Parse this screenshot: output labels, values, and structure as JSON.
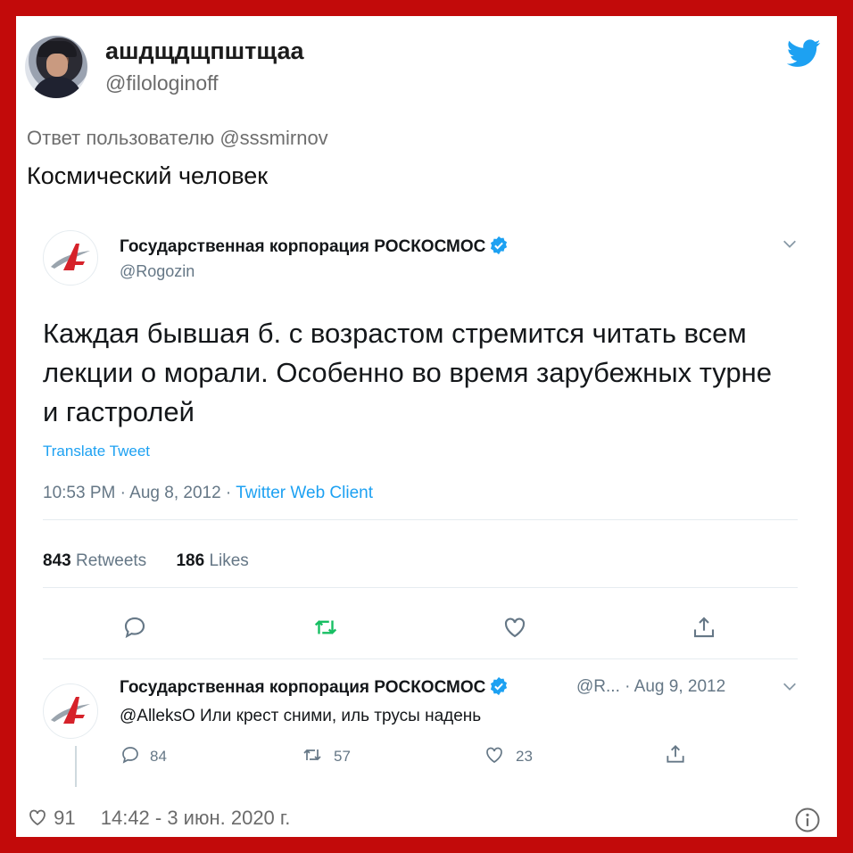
{
  "outer_tweet": {
    "name": "ашдщдщпштщаа",
    "handle": "@filologinoff",
    "reply_to": "Ответ пользователю @sssmirnov",
    "text": "Космический человек",
    "likes": "91",
    "timestamp": "14:42 - 3 июн. 2020 г."
  },
  "quoted_tweet": {
    "name": "Государственная корпорация РОСКОСМОС",
    "handle": "@Rogozin",
    "text": "Каждая бывшая б. с возрастом стремится читать всем лекции о морали. Особенно во время зарубежных турне и гастролей",
    "translate": "Translate Tweet",
    "meta_time": "10:53 PM · Aug 8, 2012 · ",
    "meta_client": "Twitter Web Client",
    "retweets_count": "843",
    "retweets_label": "Retweets",
    "likes_count": "186",
    "likes_label": "Likes"
  },
  "reply_tweet": {
    "name": "Государственная корпорация РОСКОСМОС",
    "handle_date": "@R... · Aug 9, 2012",
    "text": "@AlleksO Или крест сними, иль трусы надень",
    "replies": "84",
    "retweets": "57",
    "likes": "23"
  },
  "colors": {
    "border_red": "#c20a0a",
    "twitter_blue": "#1da1f2",
    "retweet_green": "#17bf63",
    "roscosmos_red": "#d6222a"
  }
}
